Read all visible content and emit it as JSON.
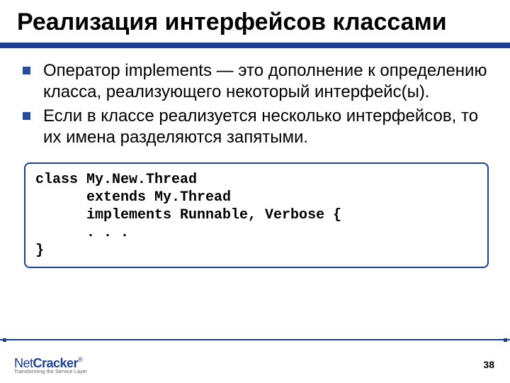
{
  "title": "Реализация интерфейсов классами",
  "bullets": [
    "Оператор implements — это дополнение к определению класса, реализующего некоторый интерфейс(ы).",
    "Если в классе реализуется несколько интерфейсов, то их имена разделяются запятыми."
  ],
  "code": "class My.New.Thread\n      extends My.Thread\n      implements Runnable, Verbose {\n      . . .\n}",
  "logo": {
    "brand_left": "Net",
    "brand_right": "Cracker",
    "registered": "®",
    "tagline": "Transforming the Service Layer"
  },
  "page_number": "38"
}
